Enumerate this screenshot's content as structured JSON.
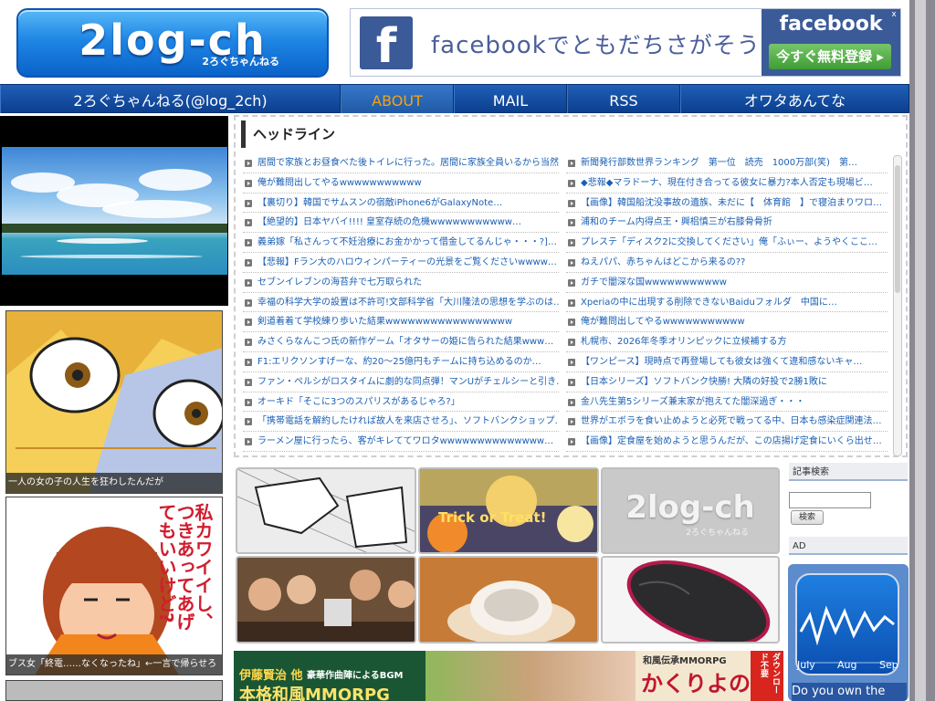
{
  "header": {
    "logo_text": "2log-ch",
    "logo_sub": "2ろぐちゃんねる",
    "fb_icon": "f",
    "fb_copy_latin": "facebook",
    "fb_copy_jp": "でともだちさがそう",
    "fb_brand": "facebook",
    "fb_cta": "今すぐ無料登録 ▸",
    "fb_close": "x"
  },
  "nav": {
    "site": "2ろぐちゃんねる(@log_2ch)",
    "about": "ABOUT",
    "mail": "MAIL",
    "rss": "RSS",
    "owata": "オワタあんてな"
  },
  "left": {
    "caption1": "一人の女の子の人生を狂わしたんだが",
    "caption2": "ブス女「終電……なくなったね」←一言で帰らせろ",
    "manga_text": "私カワイイし、つきあってあげてもいいけど?"
  },
  "headline": {
    "title": "ヘッドライン",
    "left_items": [
      "居間で家族とお昼食べた後トイレに行った。居間に家族全員いるから当然…",
      "俺が難問出してやるwwwwwwwwwww",
      "【裏切り】韓国でサムスンの宿敵iPhone6がGalaxyNote…",
      "【絶望的】日本ヤバイ!!!! 皇室存続の危機wwwwwwwwwww…",
      "義弟嫁「私さんって不妊治療にお金かかって借金してるんじゃ・・・?]…",
      "【悲報】Fラン大のハロウィンパーティーの光景をご覧くださいwwww…",
      "セブンイレブンの海苔弁で七万取られた",
      "幸福の科学大学の設置は不許可!文部科学省「大川隆法の思想を学ぶのは…",
      "剣道着着て学校練り歩いた結果wwwwwwwwwwwwwwwww",
      "みさくらなんこつ氏の新作ゲーム「オタサーの姫に告られた結果www…",
      "F1:エリクソンすげーな、約20～25億円もチームに持ち込めるのか…",
      "ファン・ペルシがロスタイムに劇的な同点弾！マンUがチェルシーと引き…",
      "オーキド「そこに3つのスパリスがあるじゃろ?」",
      "「携帯電話を解約したければ故人を来店させろ」、ソフトバンクショップ…",
      "ラーメン屋に行ったら、客がキレててワロタwwwwwwwwwwwwww…"
    ],
    "right_items": [
      "新聞発行部数世界ランキング　第一位　読売　1000万部(笑)　第…",
      "◆悲報◆マラドーナ、現在付き合ってる彼女に暴力?本人否定も現場ビ…",
      "【画像】韓国船沈没事故の遺族、未だに【　体育館　】で寝泊まりワロ…",
      "浦和のチーム内得点王・興梠慎三が右膝骨骨折",
      "プレステ「ディスク2に交換してください」俺「ふぃー、ようやくここ…",
      "ねえパパ、赤ちゃんはどこから来るの??",
      "ガチで闇深な国wwwwwwwwwww",
      "Xperiaの中に出現する削除できないBaiduフォルダ　中国に…",
      "俺が難問出してやるwwwwwwwwwww",
      "札幌市、2026年冬季オリンピックに立候補する方",
      "【ワンピース】現時点で再登場しても彼女は強くて違和感ないキャ…",
      "【日本シリーズ】ソフトバンク快勝! 大隣の好投で2勝1敗に",
      "金八先生第5シリーズ兼末家が抱えてた闇深過ぎ・・・",
      "世界がエボラを食い止めようと必死で戦ってる中、日本も感染症関連法…",
      "【画像】定食屋を始めようと思うんだが、この店揚げ定食にいくら出せ…"
    ]
  },
  "grid": {
    "trick_text": "Trick or Treat!",
    "logo_text": "2log-ch",
    "logo_sub": "2ろぐちゃんねる"
  },
  "banner": {
    "left_line1": "伊藤賢治 他",
    "left_line1b": "豪華作曲陣によるBGM",
    "left_line2": "本格和風MMORPG",
    "right_top": "和風伝承MMORPG",
    "right_title": "かくりよの門",
    "right_tag": "ダウンロード不要"
  },
  "sidebar": {
    "search_title": "記事検索",
    "search_button": "検索",
    "ad_title": "AD",
    "ad_months": [
      "July",
      "Aug",
      "Sep"
    ],
    "ad_text": "Do you own the"
  },
  "colors": {
    "nav_bg": "#1f5fb6",
    "nav_active_text": "#f2a317",
    "link": "#1a5fb4",
    "fb_blue": "#3b5a98"
  }
}
